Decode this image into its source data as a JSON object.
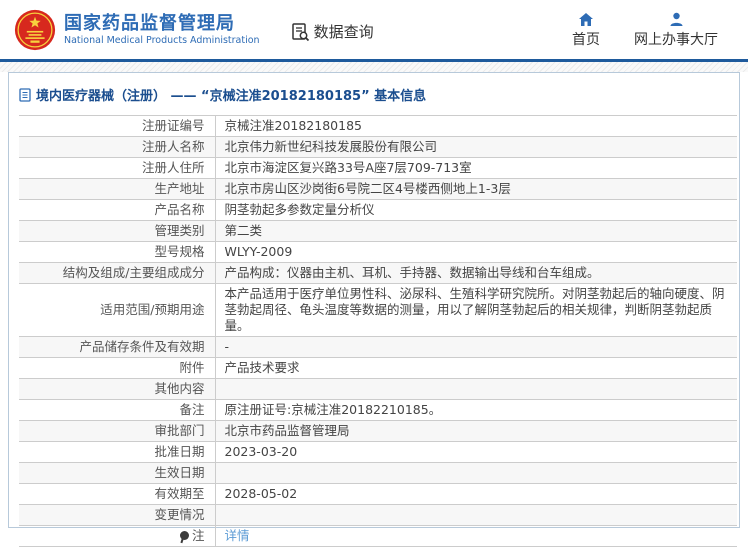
{
  "header": {
    "org_name_zh": "国家药品监督管理局",
    "org_name_en": "National Medical Products Administration",
    "nav_data_query": "数据查询",
    "nav_home": "首页",
    "nav_hall": "网上办事大厅"
  },
  "panel": {
    "title": "境内医疗器械（注册） —— “京械注准20182180185” 基本信息"
  },
  "table": {
    "rows": [
      {
        "label": "注册证编号",
        "value": "京械注准20182180185"
      },
      {
        "label": "注册人名称",
        "value": "北京伟力新世纪科技发展股份有限公司"
      },
      {
        "label": "注册人住所",
        "value": "北京市海淀区复兴路33号A座7层709-713室"
      },
      {
        "label": "生产地址",
        "value": "北京市房山区沙岗街6号院二区4号楼西侧地上1-3层"
      },
      {
        "label": "产品名称",
        "value": "阴茎勃起多参数定量分析仪"
      },
      {
        "label": "管理类别",
        "value": "第二类"
      },
      {
        "label": "型号规格",
        "value": "WLYY-2009"
      },
      {
        "label": "结构及组成/主要组成成分",
        "value": "产品构成：仪器由主机、耳机、手持器、数据输出导线和台车组成。"
      },
      {
        "label": "适用范围/预期用途",
        "value": "本产品适用于医疗单位男性科、泌尿科、生殖科学研究院所。对阴茎勃起后的轴向硬度、阴茎勃起周径、龟头温度等数据的测量，用以了解阴茎勃起后的相关规律，判断阴茎勃起质量。"
      },
      {
        "label": "产品储存条件及有效期",
        "value": "-"
      },
      {
        "label": "附件",
        "value": "产品技术要求"
      },
      {
        "label": "其他内容",
        "value": ""
      },
      {
        "label": "备注",
        "value": "原注册证号:京械注准20182210185。"
      },
      {
        "label": "审批部门",
        "value": "北京市药品监督管理局"
      },
      {
        "label": "批准日期",
        "value": "2023-03-20"
      },
      {
        "label": "生效日期",
        "value": ""
      },
      {
        "label": "有效期至",
        "value": "2028-05-02"
      },
      {
        "label": "变更情况",
        "value": ""
      },
      {
        "label": "注",
        "value": "详情",
        "is_link": true,
        "has_icon": true
      }
    ]
  },
  "colors": {
    "accent_blue": "#2e6cb5",
    "header_rule_blue": "#1e5a9c",
    "title_blue": "#1b4e8f",
    "link_blue": "#5b9bd5",
    "emblem_red": "#d7281e",
    "emblem_gold": "#f7d13e",
    "row_alt_bg": "#f7f7f7",
    "table_border": "#cccccc",
    "panel_border": "#b7c9da"
  }
}
